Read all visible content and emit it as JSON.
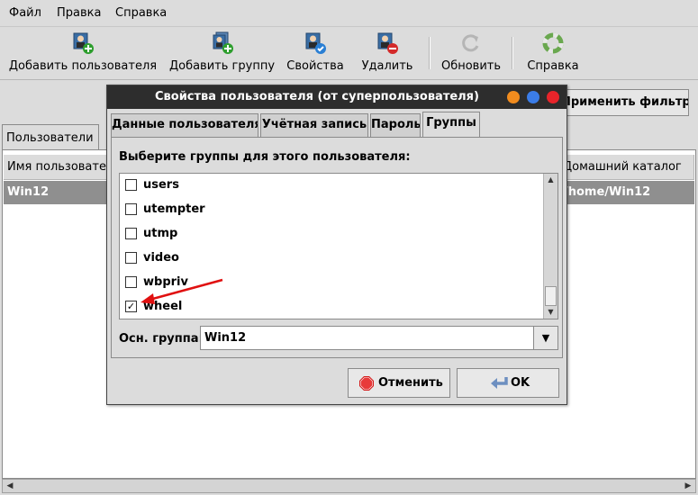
{
  "menubar": {
    "items": [
      "Файл",
      "Правка",
      "Справка"
    ]
  },
  "toolbar": {
    "buttons": [
      {
        "label": "Добавить пользователя",
        "icon": "add-user-icon"
      },
      {
        "label": "Добавить группу",
        "icon": "add-group-icon"
      },
      {
        "label": "Свойства",
        "icon": "properties-icon"
      },
      {
        "label": "Удалить",
        "icon": "delete-icon"
      },
      {
        "label": "Обновить",
        "icon": "refresh-icon"
      },
      {
        "label": "Справка",
        "icon": "help-icon"
      }
    ]
  },
  "filter": {
    "apply_label": "Применить фильтр"
  },
  "main_tabs": {
    "users": "Пользователи"
  },
  "table": {
    "columns": [
      "Имя пользователя",
      "Домашний каталог"
    ],
    "rows": [
      {
        "name": "Win12",
        "home": "/home/Win12"
      }
    ]
  },
  "dialog": {
    "title": "Свойства пользователя (от суперпользователя)",
    "tabs": [
      "Данные пользователя",
      "Учётная запись",
      "Пароль",
      "Группы"
    ],
    "active_tab": "Группы",
    "prompt": "Выберите группы для этого пользователя:",
    "groups": [
      {
        "name": "users",
        "checked": false
      },
      {
        "name": "utempter",
        "checked": false
      },
      {
        "name": "utmp",
        "checked": false
      },
      {
        "name": "video",
        "checked": false
      },
      {
        "name": "wbpriv",
        "checked": false
      },
      {
        "name": "wheel",
        "checked": true
      }
    ],
    "check_mark": "✓",
    "main_group_label": "Осн. группа:",
    "main_group_value": "Win12",
    "cancel_label": "Отменить",
    "ok_label": "OK"
  },
  "colors": {
    "accent_arrow": "#e01010",
    "title_bar": "#2d2d2d",
    "selected_row": "#8f8f8f"
  }
}
